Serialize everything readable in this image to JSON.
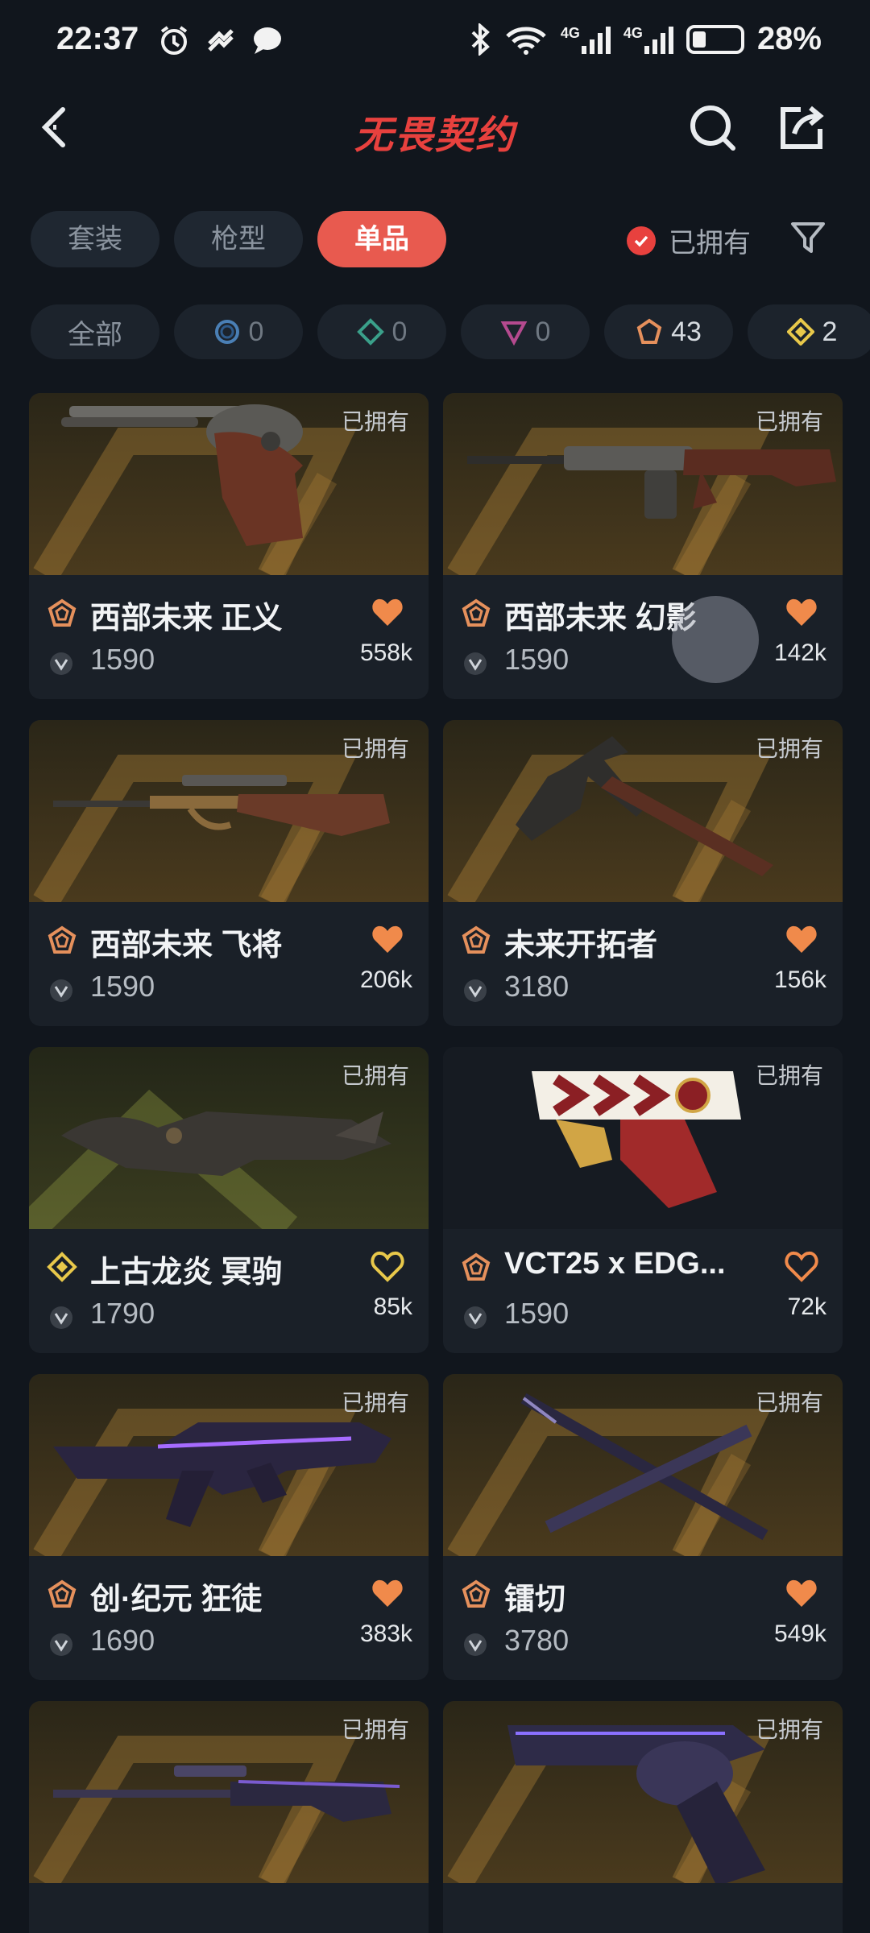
{
  "status": {
    "time": "22:37",
    "battery": "28%",
    "net1": "4G",
    "net2": "4G",
    "wifi_badge": "6"
  },
  "header": {
    "title": "无畏契约"
  },
  "tabs": [
    {
      "label": "套装",
      "active": false
    },
    {
      "label": "枪型",
      "active": false
    },
    {
      "label": "单品",
      "active": true
    }
  ],
  "owned_filter": {
    "label": "已拥有",
    "checked": true
  },
  "rarity_chips": [
    {
      "label": "全部"
    },
    {
      "icon": "select-tier-icon",
      "count": "0",
      "color": "#4a7fb5"
    },
    {
      "icon": "deluxe-tier-icon",
      "count": "0",
      "color": "#3aa08a"
    },
    {
      "icon": "premium-tier-icon",
      "count": "0",
      "color": "#b54a8f"
    },
    {
      "icon": "exclusive-tier-icon",
      "count": "43",
      "color": "#e5905c"
    },
    {
      "icon": "ultra-tier-icon",
      "count": "2",
      "color": "#e8c84a"
    }
  ],
  "items": [
    {
      "name": "西部未来 正义",
      "price": "1590",
      "likes": "558k",
      "owned": "已拥有",
      "tier": "exclusive",
      "liked": true
    },
    {
      "name": "西部未来 幻影",
      "price": "1590",
      "likes": "142k",
      "owned": "已拥有",
      "tier": "exclusive",
      "liked": true
    },
    {
      "name": "西部未来 飞将",
      "price": "1590",
      "likes": "206k",
      "owned": "已拥有",
      "tier": "exclusive",
      "liked": true
    },
    {
      "name": "未来开拓者",
      "price": "3180",
      "likes": "156k",
      "owned": "已拥有",
      "tier": "exclusive",
      "liked": true
    },
    {
      "name": "上古龙炎 冥驹",
      "price": "1790",
      "likes": "85k",
      "owned": "已拥有",
      "tier": "ultra",
      "liked": false
    },
    {
      "name": "VCT25 x EDG...",
      "price": "1590",
      "likes": "72k",
      "owned": "已拥有",
      "tier": "exclusive",
      "liked": false
    },
    {
      "name": "创·纪元 狂徒",
      "price": "1690",
      "likes": "383k",
      "owned": "已拥有",
      "tier": "exclusive",
      "liked": true
    },
    {
      "name": "镭切",
      "price": "3780",
      "likes": "549k",
      "owned": "已拥有",
      "tier": "exclusive",
      "liked": true
    },
    {
      "name": "",
      "price": "",
      "likes": "",
      "owned": "已拥有",
      "tier": "exclusive",
      "liked": false
    },
    {
      "name": "",
      "price": "",
      "likes": "",
      "owned": "已拥有",
      "tier": "exclusive",
      "liked": false
    }
  ],
  "colors": {
    "accent": "#e8413e",
    "exclusive": "#e5905c",
    "ultra": "#e8c84a",
    "heart": "#f08a4b"
  }
}
